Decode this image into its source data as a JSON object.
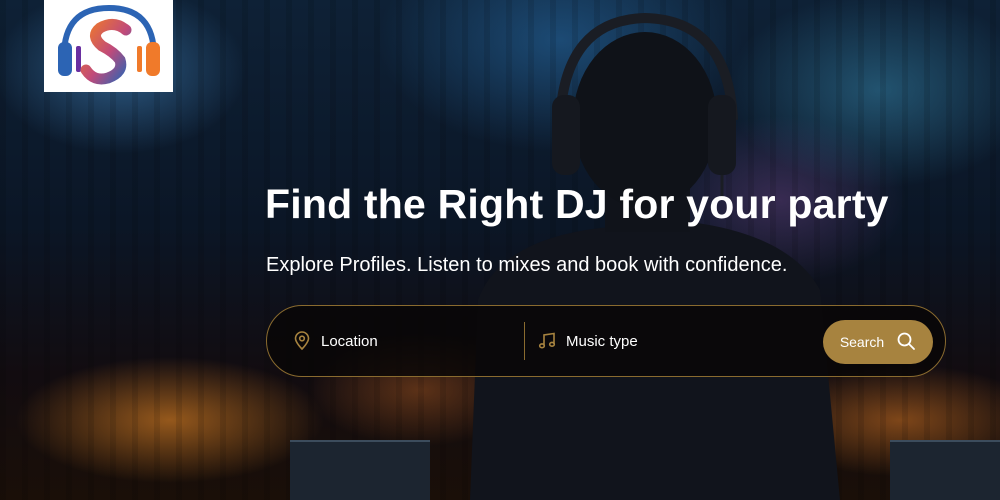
{
  "brand": {
    "logo_icon": "headphones-s-logo",
    "colors": {
      "orange": "#f07a2a",
      "blue": "#2c64b4",
      "purple": "#6a2fa0"
    }
  },
  "hero": {
    "headline": "Find the Right DJ for your party",
    "subheadline": "Explore Profiles. Listen to mixes and book with confidence."
  },
  "search": {
    "location": {
      "icon": "location-pin-icon",
      "label": "Location"
    },
    "music_type": {
      "icon": "music-note-icon",
      "label": "Music type"
    },
    "button": {
      "label": "Search",
      "icon": "search-icon"
    },
    "accent_color": "#a7833f"
  }
}
